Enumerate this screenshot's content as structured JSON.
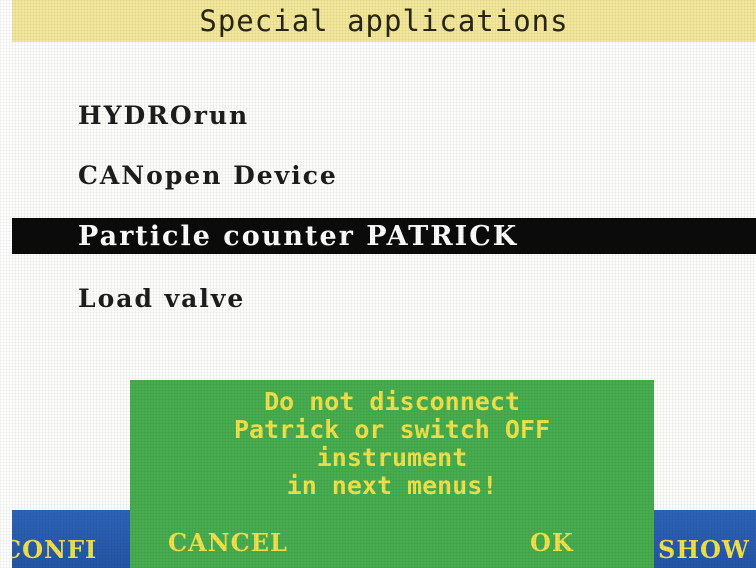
{
  "header": {
    "title": "Special applications"
  },
  "menu": {
    "items": [
      {
        "label": "HYDROrun"
      },
      {
        "label": "CANopen Device"
      },
      {
        "label": "Particle counter PATRICK",
        "selected": true
      },
      {
        "label": "Load valve"
      }
    ]
  },
  "softkeys": {
    "left_label": "CONFI",
    "right_label": "SHOW"
  },
  "dialog": {
    "message_lines": [
      "Do not disconnect",
      "Patrick or switch OFF",
      "instrument",
      "in next menus!"
    ],
    "cancel_label": "CANCEL",
    "ok_label": "OK"
  },
  "colors": {
    "title_bar": "#f3e89a",
    "selection": "#0b0b0b",
    "softkey_bar": "#2355a6",
    "dialog_background": "#47ad4f",
    "dialog_text": "#f1e14a"
  }
}
